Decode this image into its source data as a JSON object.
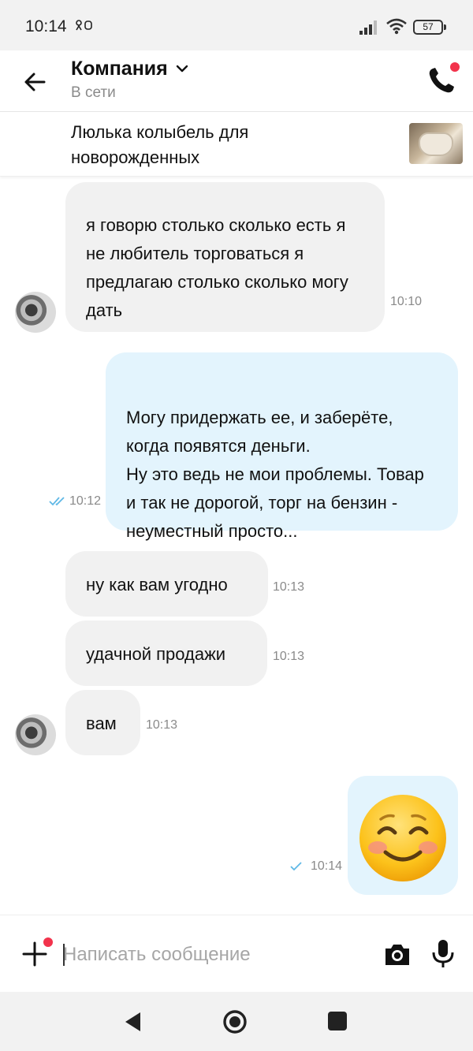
{
  "status": {
    "time": "10:14",
    "glyph": "⚘⚪",
    "battery": "57"
  },
  "header": {
    "title": "Компания",
    "subtitle": "В сети"
  },
  "product": {
    "title": "Люлька колыбель для новорожденных"
  },
  "messages": [
    {
      "dir": "in",
      "text": "я говорю столько сколько есть я не любитель торговаться я предлагаю столько сколько могу дать",
      "time": "10:10"
    },
    {
      "dir": "out",
      "text": "Могу придержать ее, и заберёте, когда появятся деньги.\nНу это ведь не мои проблемы. Товар и так не дорогой, торг на бензин - неуместный просто...",
      "time": "10:12"
    },
    {
      "dir": "in",
      "text": "ну как вам угодно",
      "time": "10:13"
    },
    {
      "dir": "in",
      "text": "удачной продажи",
      "time": "10:13"
    },
    {
      "dir": "in",
      "text": "вам",
      "time": "10:13"
    },
    {
      "dir": "out",
      "text": "",
      "emoji": "smiling-face-with-blush",
      "time": "10:14"
    }
  ],
  "input": {
    "placeholder": "Написать сообщение"
  },
  "colors": {
    "accent_red": "#f2334c",
    "outgoing_bubble": "#e3f4fd",
    "incoming_bubble": "#f1f1f1",
    "tick_blue": "#5fb8e6"
  }
}
